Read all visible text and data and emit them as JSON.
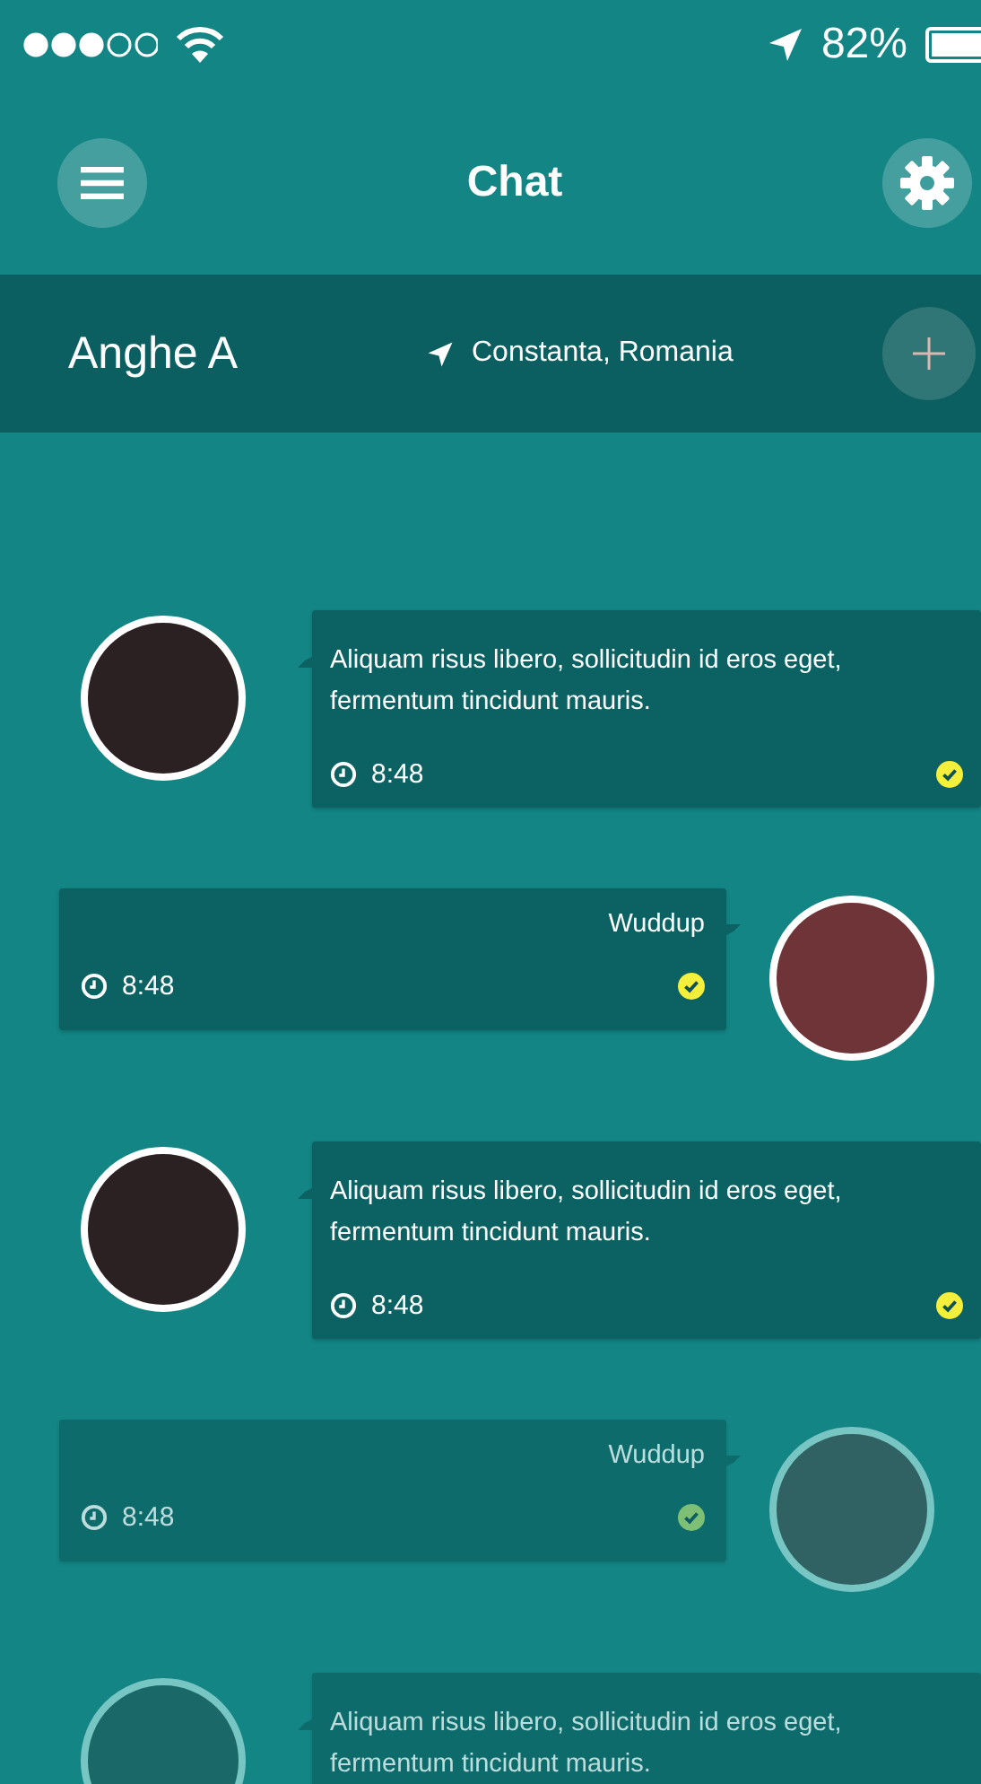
{
  "status_bar": {
    "battery": "82%"
  },
  "header": {
    "title": "Chat"
  },
  "contact": {
    "name": "Anghe A",
    "location": "Constanta, Romania"
  },
  "messages": [
    {
      "kind": "incoming",
      "text": "Aliquam risus libero, sollicitudin id eros eget, fermentum tincidunt mauris.",
      "time": "8:48",
      "color": "#2b2022",
      "faded": false
    },
    {
      "kind": "outgoing",
      "text": "Wuddup",
      "time": "8:48",
      "color": "#6e3437",
      "faded": false
    },
    {
      "kind": "incoming",
      "text": "Aliquam risus libero, sollicitudin id eros eget, fermentum tincidunt mauris.",
      "time": "8:48",
      "color": "#2b2022",
      "faded": false
    },
    {
      "kind": "outgoing",
      "text": "Wuddup",
      "time": "8:48",
      "color": "#3c5557",
      "faded": true
    },
    {
      "kind": "incoming",
      "text": "Aliquam risus libero, sollicitudin id eros eget, fermentum tincidunt mauris.",
      "color": "#1f5e5f",
      "faded": true
    }
  ]
}
